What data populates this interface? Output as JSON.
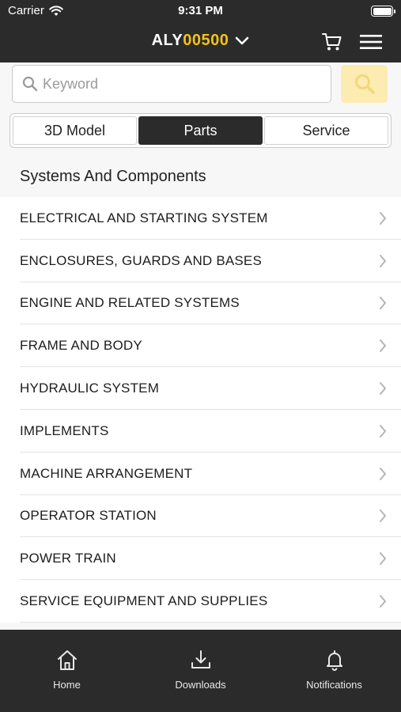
{
  "status_bar": {
    "carrier": "Carrier",
    "time": "9:31 PM"
  },
  "header": {
    "model_prefix": "ALY",
    "model_number": "00500",
    "icons": [
      "chevron-down-icon",
      "cart-icon",
      "hamburger-menu-icon"
    ],
    "accent_color": "#f5c11b"
  },
  "search": {
    "placeholder": "Keyword",
    "value": ""
  },
  "tabs": [
    {
      "label": "3D Model",
      "active": false
    },
    {
      "label": "Parts",
      "active": true
    },
    {
      "label": "Service",
      "active": false
    }
  ],
  "section": {
    "title": "Systems And Components"
  },
  "components": [
    "ELECTRICAL AND STARTING SYSTEM",
    "ENCLOSURES, GUARDS AND BASES",
    "ENGINE AND RELATED SYSTEMS",
    "FRAME AND BODY",
    "HYDRAULIC SYSTEM",
    "IMPLEMENTS",
    "MACHINE ARRANGEMENT",
    "OPERATOR STATION",
    "POWER TRAIN",
    "SERVICE EQUIPMENT AND SUPPLIES"
  ],
  "bottom_nav": [
    {
      "label": "Home",
      "icon": "home-icon"
    },
    {
      "label": "Downloads",
      "icon": "download-icon"
    },
    {
      "label": "Notifications",
      "icon": "bell-icon"
    }
  ]
}
